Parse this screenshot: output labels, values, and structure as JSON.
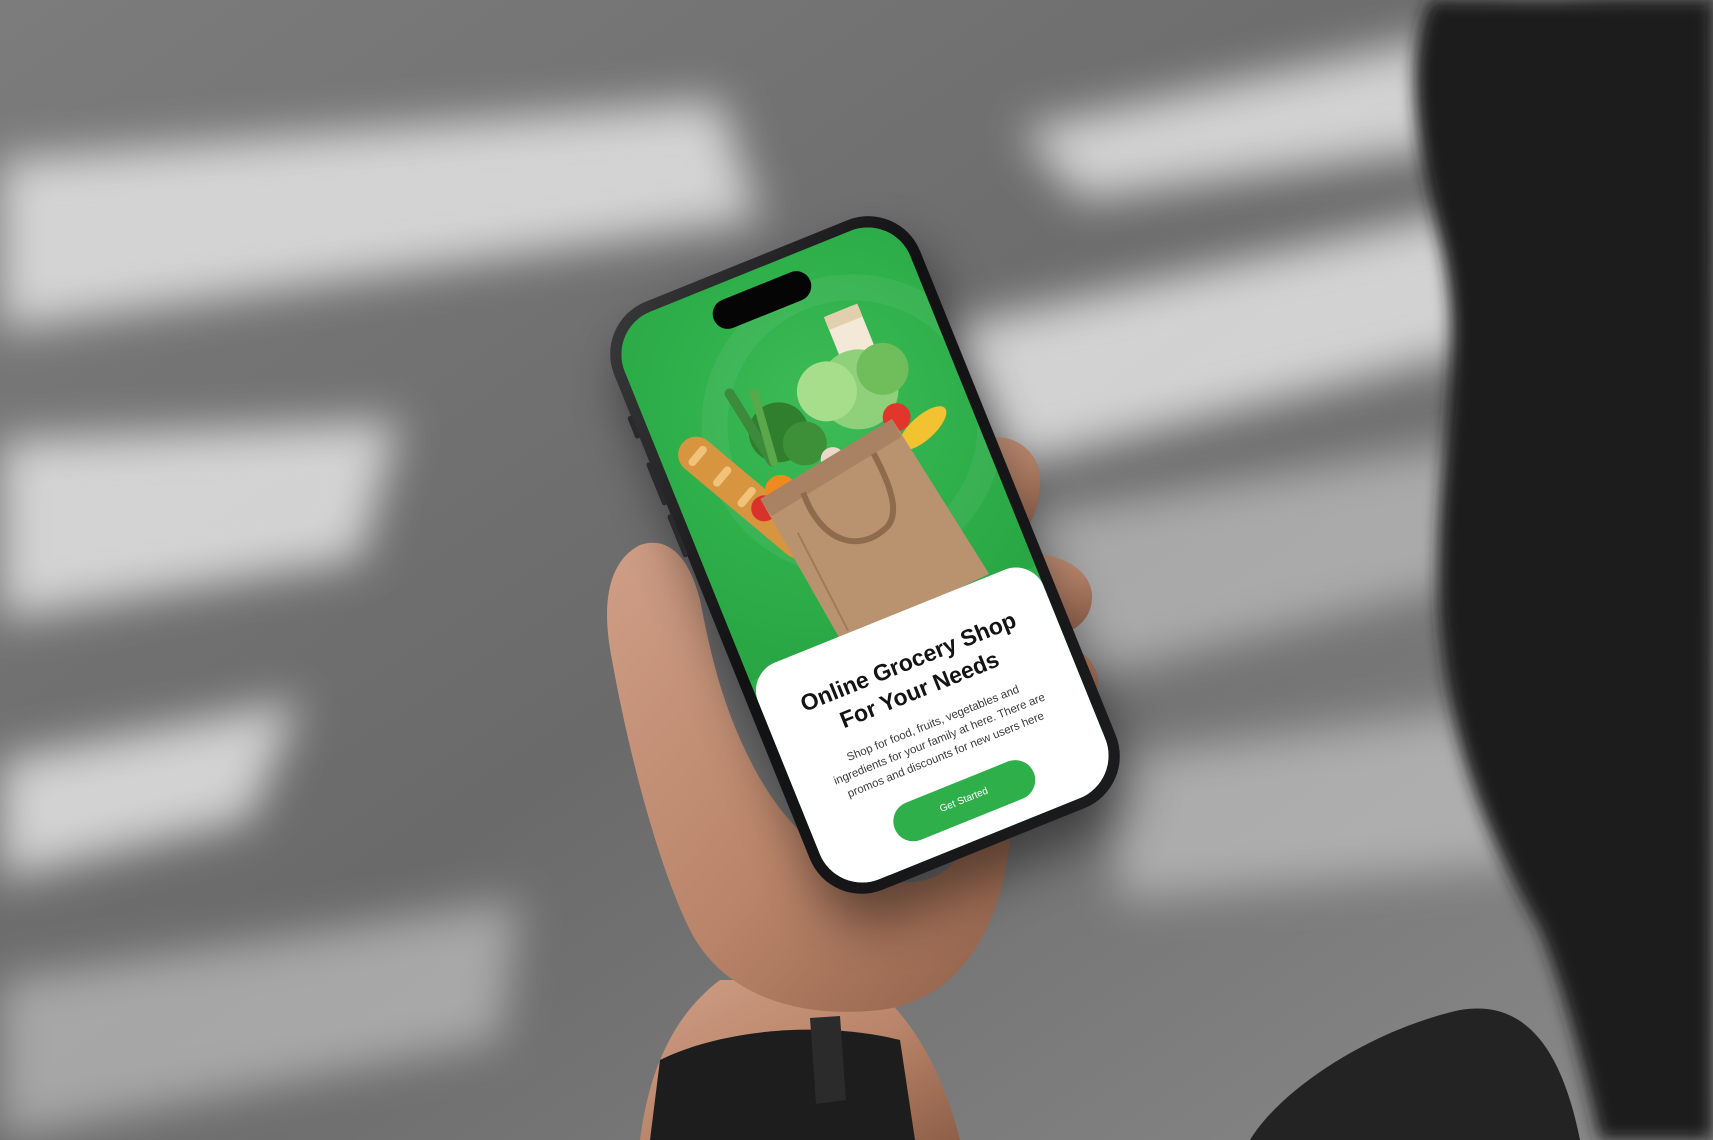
{
  "colors": {
    "brand_green": "#2eaf4a",
    "card_background": "#ffffff",
    "title_text": "#141414",
    "body_text": "#3b3b3b",
    "button_text": "#ffffff"
  },
  "icons": [
    "grocery-bag-icon"
  ],
  "onboarding": {
    "title_lines": [
      "Online Grocery Shop",
      "For Your Needs"
    ],
    "description": "Shop for food, fruits, vegetables and ingredients for your family at here. There are promos and discounts for new users here",
    "cta_label": "Get Started"
  }
}
